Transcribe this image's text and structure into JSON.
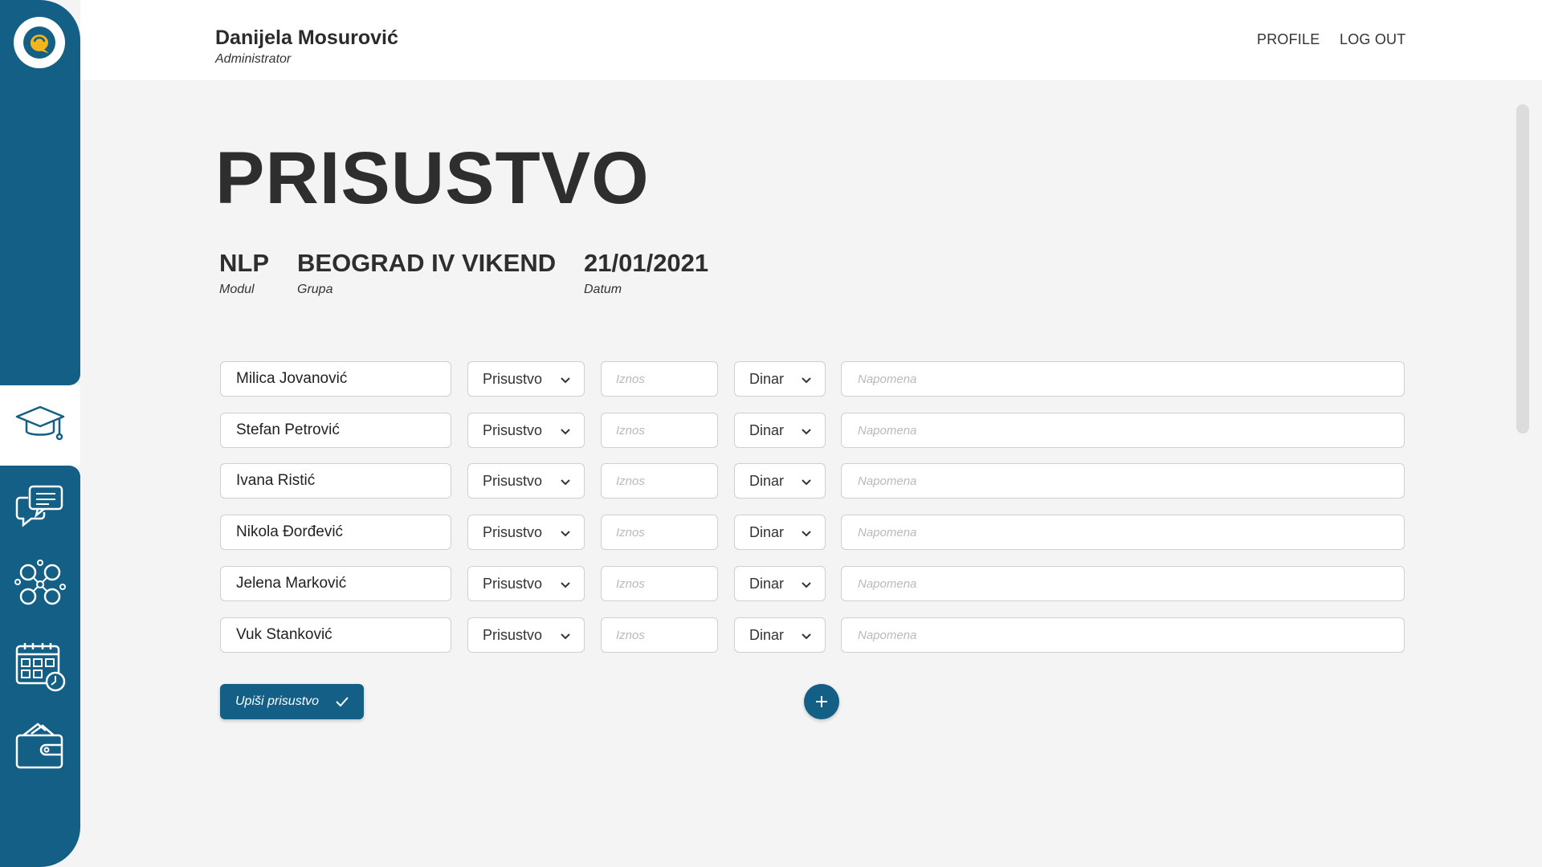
{
  "header": {
    "user_name": "Danijela Mosurović",
    "user_role": "Administrator",
    "nav": {
      "profile": "PROFILE",
      "logout": "LOG OUT"
    }
  },
  "sidebar": {
    "logo_icon": "chat-bubble-logo-icon",
    "items": [
      {
        "icon": "graduation-cap-icon"
      },
      {
        "icon": "messages-icon"
      },
      {
        "icon": "people-network-icon"
      },
      {
        "icon": "calendar-clock-icon"
      },
      {
        "icon": "wallet-icon"
      }
    ]
  },
  "main": {
    "title": "PRISUSTVO",
    "meta": {
      "modul": {
        "value": "NLP",
        "label": "Modul"
      },
      "grupa": {
        "value": "BEOGRAD IV VIKEND",
        "label": "Grupa"
      },
      "datum": {
        "value": "21/01/2021",
        "label": "Datum"
      }
    },
    "rows": [
      {
        "name": "Milica Jovanović",
        "attendance": "Prisustvo",
        "amount_placeholder": "Iznos",
        "currency": "Dinar",
        "note_placeholder": "Napomena"
      },
      {
        "name": "Stefan Petrović",
        "attendance": "Prisustvo",
        "amount_placeholder": "Iznos",
        "currency": "Dinar",
        "note_placeholder": "Napomena"
      },
      {
        "name": "Ivana Ristić",
        "attendance": "Prisustvo",
        "amount_placeholder": "Iznos",
        "currency": "Dinar",
        "note_placeholder": "Napomena"
      },
      {
        "name": "Nikola Đorđević",
        "attendance": "Prisustvo",
        "amount_placeholder": "Iznos",
        "currency": "Dinar",
        "note_placeholder": "Napomena"
      },
      {
        "name": "Jelena Marković",
        "attendance": "Prisustvo",
        "amount_placeholder": "Iznos",
        "currency": "Dinar",
        "note_placeholder": "Napomena"
      },
      {
        "name": "Vuk Stanković",
        "attendance": "Prisustvo",
        "amount_placeholder": "Iznos",
        "currency": "Dinar",
        "note_placeholder": "Napomena"
      }
    ],
    "save_button": "Upiši prisustvo",
    "add_button_icon": "plus-icon"
  },
  "colors": {
    "brand": "#135f85",
    "logo_accent": "#f2b51c",
    "background": "#f4f4f4"
  }
}
